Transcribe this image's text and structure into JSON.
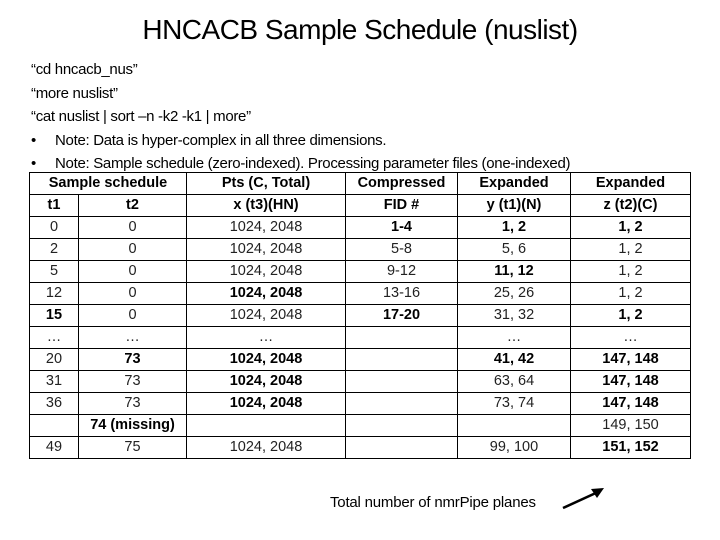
{
  "title": "HNCACB Sample Schedule (nuslist)",
  "commands": [
    "“cd hncacb_nus”",
    "“more nuslist”",
    "“cat nuslist | sort –n -k2 -k1 | more”"
  ],
  "notes": [
    "Note: Data is hyper-complex in all three dimensions.",
    "Note: Sample schedule (zero-indexed). Processing parameter files (one-indexed)"
  ],
  "bullet_glyph": "•",
  "table": {
    "header_row1": {
      "sample_schedule": "Sample schedule",
      "pts": "Pts (C, Total)",
      "compressed": "Compressed",
      "expanded_y": "Expanded",
      "expanded_z": "Expanded"
    },
    "header_row2": {
      "t1": "t1",
      "t2": "t2",
      "pts": "x (t3)(HN)",
      "compressed": "FID #",
      "expanded_y": "y (t1)(N)",
      "expanded_z": "z (t2)(C)"
    },
    "rows": [
      {
        "t1": "0",
        "t2": "0",
        "pts": "1024, 2048",
        "fid": "1-4",
        "y": "1, 2",
        "z": "1, 2"
      },
      {
        "t1": "2",
        "t2": "0",
        "pts": "1024, 2048",
        "fid": "5-8",
        "y": "5, 6",
        "z": "1, 2"
      },
      {
        "t1": "5",
        "t2": "0",
        "pts": "1024, 2048",
        "fid": "9-12",
        "y": "11, 12",
        "z": "1, 2"
      },
      {
        "t1": "12",
        "t2": "0",
        "pts": "1024, 2048",
        "fid": "13-16",
        "y": "25, 26",
        "z": "1, 2"
      },
      {
        "t1": "15",
        "t2": "0",
        "pts": "1024, 2048",
        "fid": "17-20",
        "y": "31, 32",
        "z": "1, 2"
      },
      {
        "t1": "…",
        "t2": "…",
        "pts": "…",
        "fid": "",
        "y": "…",
        "z": "…"
      },
      {
        "t1": "20",
        "t2": "73",
        "pts": "1024, 2048",
        "fid": "",
        "y": "41, 42",
        "z": "147, 148"
      },
      {
        "t1": "31",
        "t2": "73",
        "pts": "1024, 2048",
        "fid": "",
        "y": "63, 64",
        "z": "147, 148"
      },
      {
        "t1": "36",
        "t2": "73",
        "pts": "1024, 2048",
        "fid": "",
        "y": "73, 74",
        "z": "147, 148"
      },
      {
        "t1": "",
        "t2": "74 (missing)",
        "pts": "",
        "fid": "",
        "y": "",
        "z": "149, 150"
      },
      {
        "t1": "49",
        "t2": "75",
        "pts": "1024, 2048",
        "fid": "",
        "y": "99, 100",
        "z": "151, 152"
      }
    ]
  },
  "footnote": "Total number of nmrPipe planes",
  "arrow_icon": "arrow-up-right-icon"
}
